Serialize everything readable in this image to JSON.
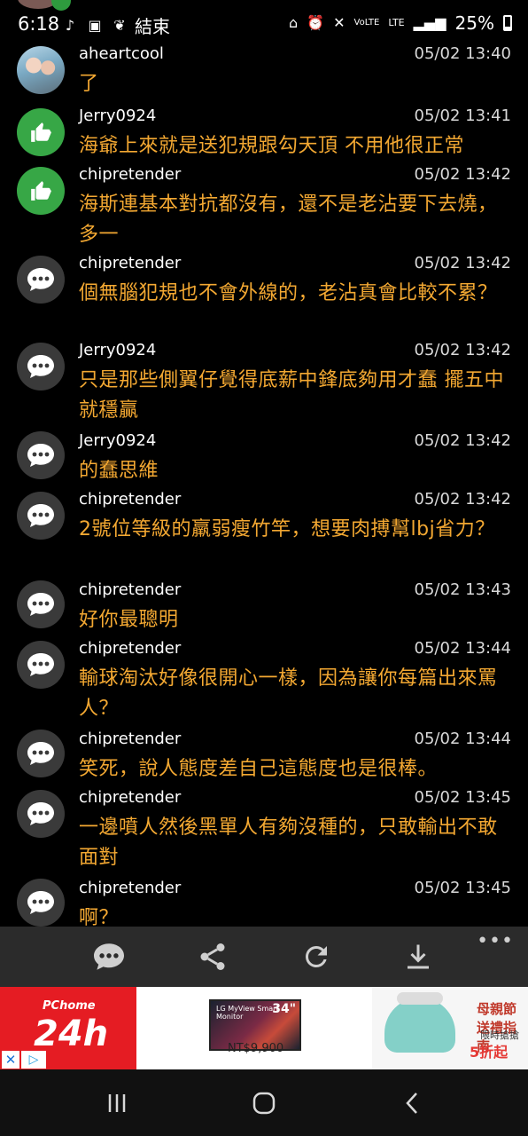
{
  "status_bar": {
    "time": "6:18",
    "notification_text": "結束",
    "battery": "25%",
    "icons": [
      "tiktok-icon",
      "app-icon",
      "leaf-icon",
      "sleep-icon",
      "alarm-icon",
      "mute-icon",
      "volte-icon",
      "lte-icon",
      "signal-icon",
      "battery-icon"
    ]
  },
  "messages": [
    {
      "user": "aheartcool",
      "time": "05/02 13:40",
      "text": "了",
      "avatar": "photo"
    },
    {
      "user": "Jerry0924",
      "time": "05/02 13:41",
      "text": "海爺上來就是送犯規跟勾天頂 不用他很正常",
      "avatar": "thumbs-up"
    },
    {
      "user": "chipretender",
      "time": "05/02 13:42",
      "text": "海斯連基本對抗都沒有，還不是老沾要下去燒，多一",
      "avatar": "thumbs-up"
    },
    {
      "user": "chipretender",
      "time": "05/02 13:42",
      "text": "個無腦犯規也不會外線的，老沾真會比較不累？",
      "avatar": "comment"
    },
    {
      "user": "Jerry0924",
      "time": "05/02 13:42",
      "text": "只是那些側翼仔覺得底薪中鋒底夠用才蠢 擺五中就穩贏",
      "avatar": "comment"
    },
    {
      "user": "Jerry0924",
      "time": "05/02 13:42",
      "text": "的蠢思維",
      "avatar": "comment"
    },
    {
      "user": "chipretender",
      "time": "05/02 13:42",
      "text": "2號位等級的羸弱瘦竹竿，想要肉搏幫lbj省力？",
      "avatar": "comment"
    },
    {
      "user": "chipretender",
      "time": "05/02 13:43",
      "text": "好你最聰明",
      "avatar": "comment"
    },
    {
      "user": "chipretender",
      "time": "05/02 13:44",
      "text": "輸球淘汰好像很開心一樣，因為讓你每篇出來罵人？",
      "avatar": "comment"
    },
    {
      "user": "chipretender",
      "time": "05/02 13:44",
      "text": "笑死，說人態度差自己這態度也是很棒。",
      "avatar": "comment"
    },
    {
      "user": "chipretender",
      "time": "05/02 13:45",
      "text": "一邊噴人然後黑單人有夠沒種的，只敢輸出不敢面對",
      "avatar": "comment"
    },
    {
      "user": "chipretender",
      "time": "05/02 13:45",
      "text": "啊？",
      "avatar": "comment"
    }
  ],
  "toolbar": {
    "items": [
      "comment-icon",
      "share-icon",
      "refresh-icon",
      "download-icon"
    ],
    "more": "•••"
  },
  "ad": {
    "brand": "PChome",
    "brand_big": "24h",
    "monitor_brand": "LG MyView Smart Monitor",
    "monitor_size": "34\"",
    "price": "NT$9,900",
    "promo_title": "母親節 送禮指南",
    "promo_sub": "限時搶搶",
    "promo_badge": "5折起",
    "close": "✕",
    "info": "▷"
  },
  "colors": {
    "background": "#000000",
    "message_text": "#f3a832",
    "toolbar": "#2b2b2b",
    "green_avatar": "#37a746"
  }
}
